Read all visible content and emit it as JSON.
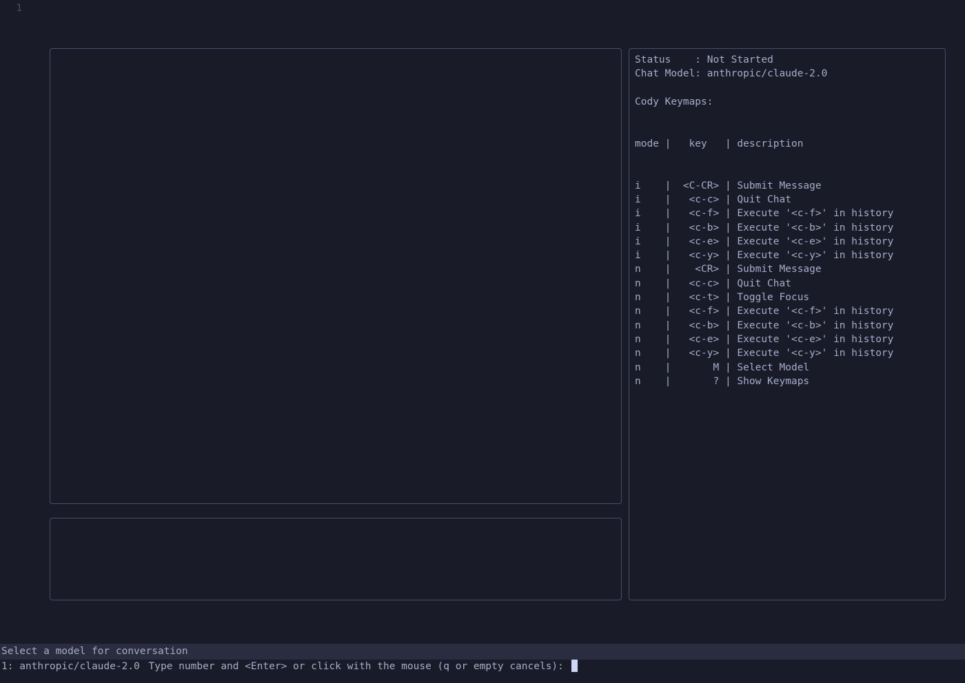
{
  "gutter": {
    "line": "1"
  },
  "sidebar": {
    "status_label": "Status    :",
    "status_value": "Not Started",
    "model_label": "Chat Model:",
    "model_value": "anthropic/claude-2.0",
    "keymaps_title": "Cody Keymaps:",
    "header": {
      "mode": "mode",
      "key": "key",
      "desc": "description"
    },
    "rows": [
      {
        "mode": "i",
        "key": "<C-CR>",
        "desc": "Submit Message"
      },
      {
        "mode": "i",
        "key": "<c-c>",
        "desc": "Quit Chat"
      },
      {
        "mode": "i",
        "key": "<c-f>",
        "desc": "Execute '<c-f>' in history"
      },
      {
        "mode": "i",
        "key": "<c-b>",
        "desc": "Execute '<c-b>' in history"
      },
      {
        "mode": "i",
        "key": "<c-e>",
        "desc": "Execute '<c-e>' in history"
      },
      {
        "mode": "i",
        "key": "<c-y>",
        "desc": "Execute '<c-y>' in history"
      },
      {
        "mode": "n",
        "key": "<CR>",
        "desc": "Submit Message"
      },
      {
        "mode": "n",
        "key": "<c-c>",
        "desc": "Quit Chat"
      },
      {
        "mode": "n",
        "key": "<c-t>",
        "desc": "Toggle Focus"
      },
      {
        "mode": "n",
        "key": "<c-f>",
        "desc": "Execute '<c-f>' in history"
      },
      {
        "mode": "n",
        "key": "<c-b>",
        "desc": "Execute '<c-b>' in history"
      },
      {
        "mode": "n",
        "key": "<c-e>",
        "desc": "Execute '<c-e>' in history"
      },
      {
        "mode": "n",
        "key": "<c-y>",
        "desc": "Execute '<c-y>' in history"
      },
      {
        "mode": "n",
        "key": "M",
        "desc": "Select Model"
      },
      {
        "mode": "n",
        "key": "?",
        "desc": "Show Keymaps"
      }
    ]
  },
  "prompt": {
    "line1": "Select a model for conversation",
    "line2": "1: anthropic/claude-2.0",
    "line3": "Type number and <Enter> or click with the mouse (q or empty cancels): "
  }
}
